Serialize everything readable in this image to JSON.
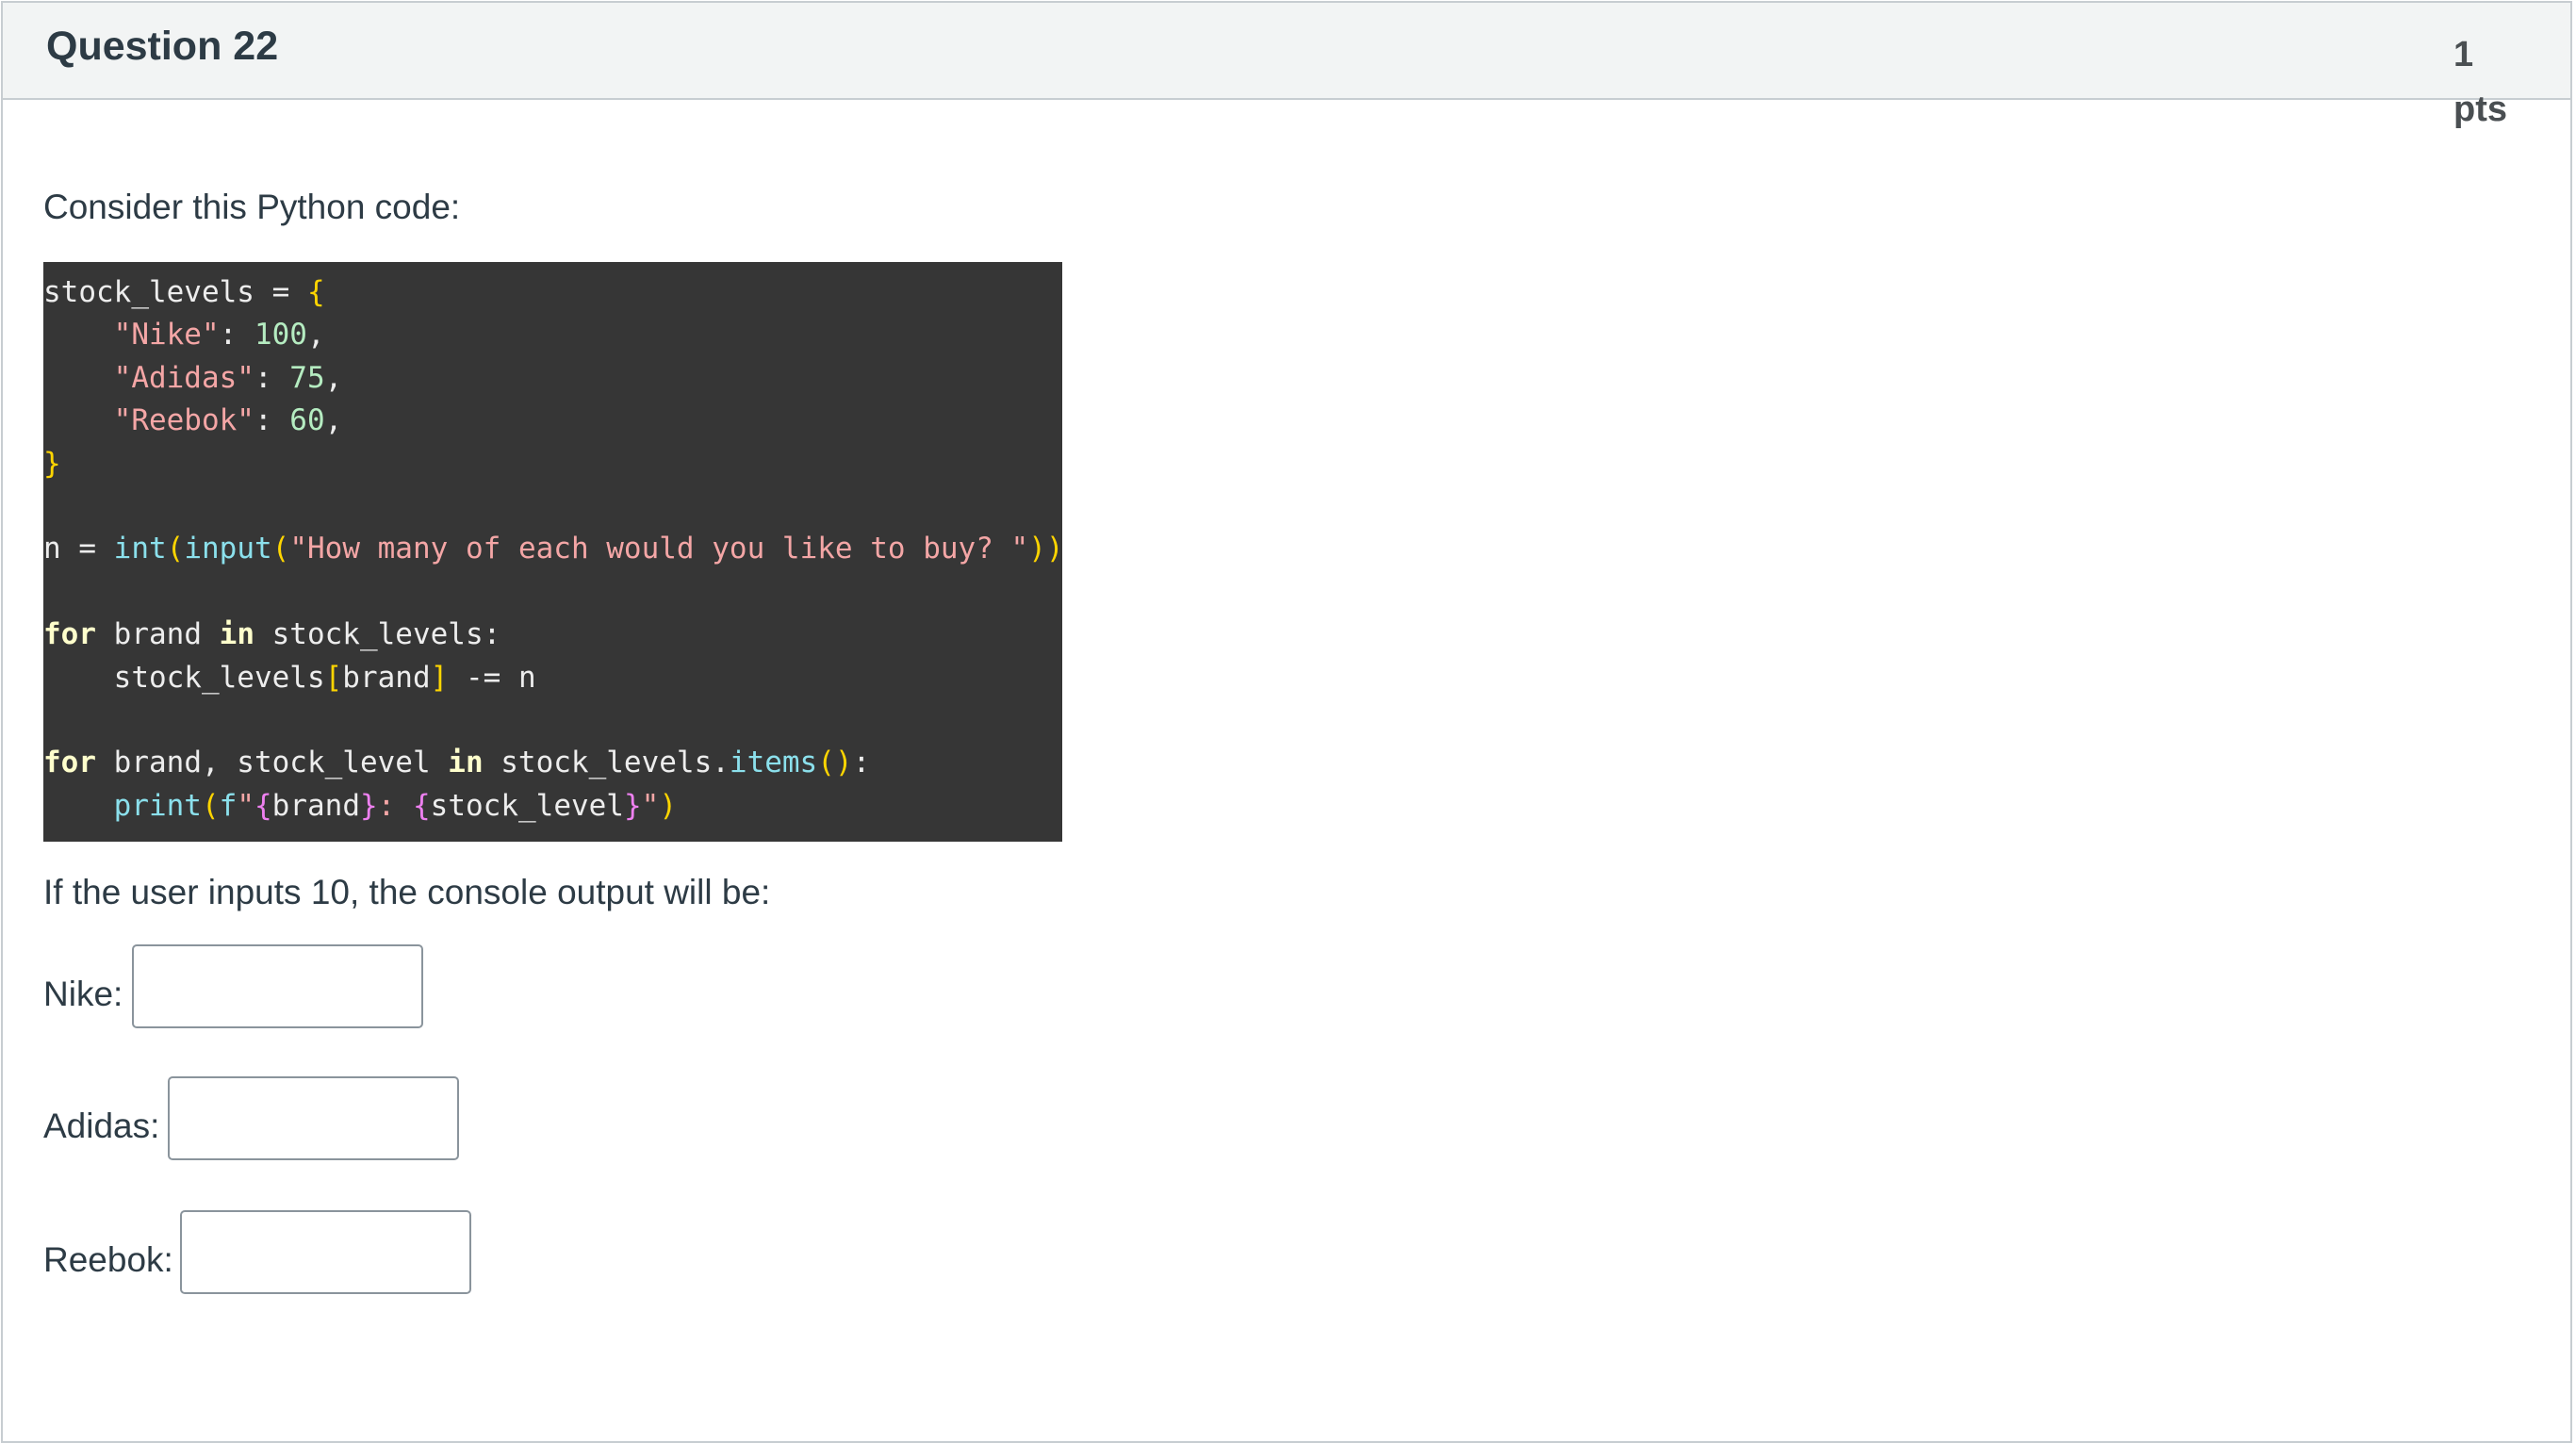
{
  "question": {
    "title": "Question 22",
    "points_value": "1",
    "points_unit": "pts"
  },
  "prompt": {
    "intro": "Consider this Python code:",
    "after_code": "If the user inputs 10, the console output will be:"
  },
  "code": {
    "language": "python",
    "lines": [
      "stock_levels = {",
      "    \"Nike\": 100,",
      "    \"Adidas\": 75,",
      "    \"Reebok\": 60,",
      "}",
      "",
      "n = int(input(\"How many of each would you like to buy? \"))",
      "",
      "for brand in stock_levels:",
      "    stock_levels[brand] -= n",
      "",
      "for brand, stock_level in stock_levels.items():",
      "    print(f\"{brand}: {stock_level}\")"
    ]
  },
  "answers": [
    {
      "label": "Nike:",
      "value": ""
    },
    {
      "label": "Adidas:",
      "value": ""
    },
    {
      "label": "Reebok:",
      "value": ""
    }
  ],
  "colors": {
    "header_bg": "#f2f4f4",
    "border": "#c7cdd1",
    "text": "#2d3b45",
    "code_bg": "#363636",
    "code_text": "#ededed",
    "code_keyword": "#ffffcc",
    "code_brace": "#ffd500",
    "code_string": "#f4a6a6",
    "code_number": "#b5ecc1",
    "code_function": "#8be0ec",
    "code_interpolation": "#ee80f0"
  }
}
